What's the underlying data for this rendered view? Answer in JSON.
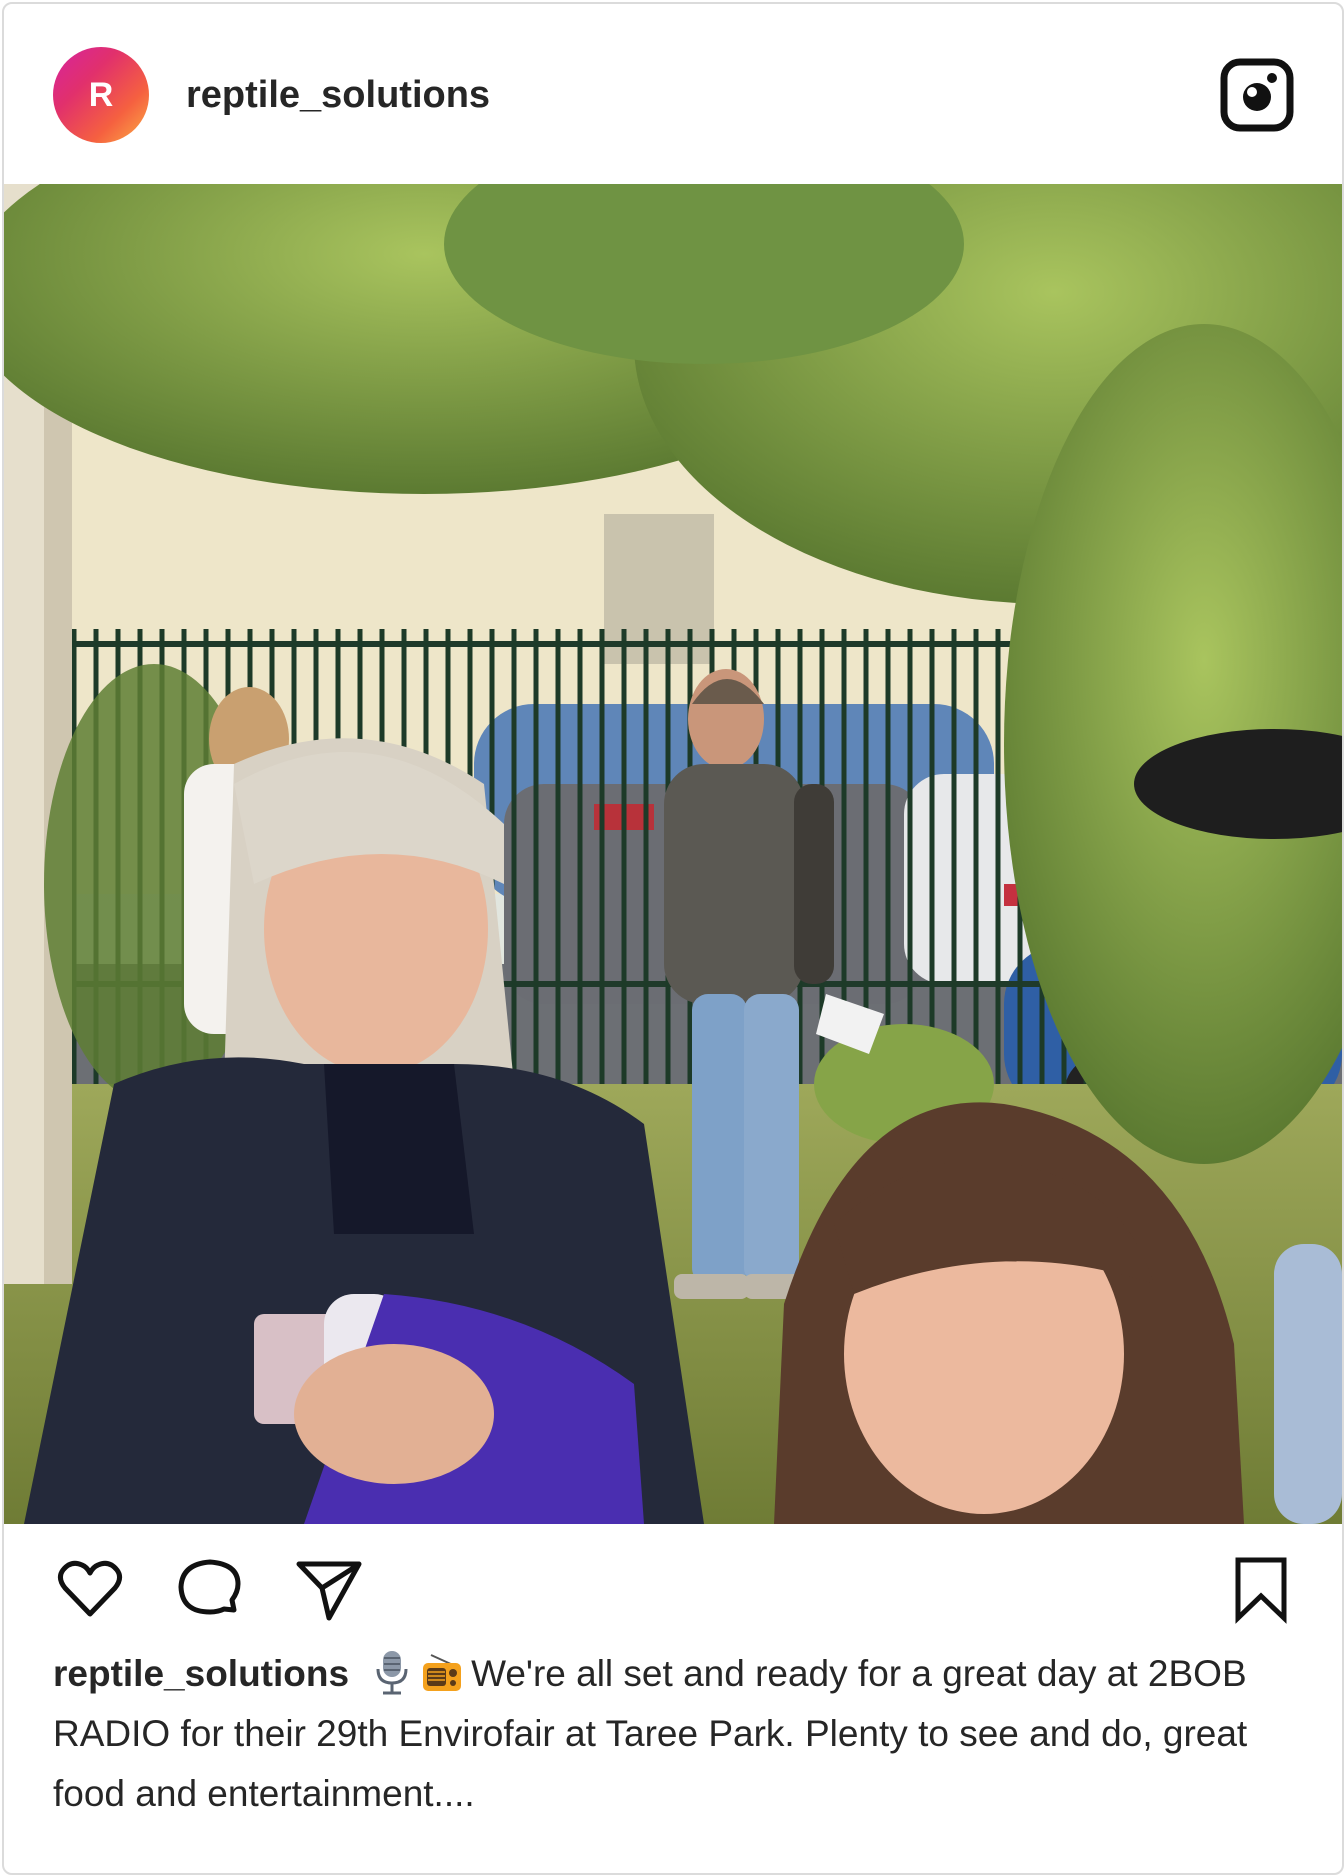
{
  "post": {
    "username": "reptile_solutions",
    "avatar_initial": "R",
    "caption_user": "reptile_solutions",
    "caption_text": "We're all set and ready for a great day at 2BOB RADIO for their 29th Envirofair at Taree Park. Plenty to see and do, great food and entertainment....",
    "emojis": [
      "studio-microphone",
      "radio"
    ]
  },
  "icons": {
    "header": "instagram-logo-icon",
    "actions": [
      "heart-icon",
      "comment-icon",
      "share-icon",
      "bookmark-icon"
    ]
  },
  "colors": {
    "avatar_gradient": [
      "#d6249f",
      "#e1306c",
      "#f56040",
      "#fcaf45"
    ],
    "text": "#262626",
    "border": "#dbdbdb"
  }
}
